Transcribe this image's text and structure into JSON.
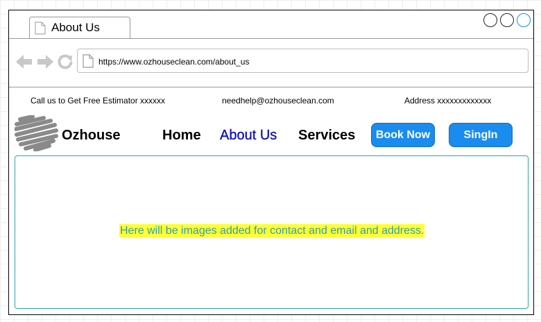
{
  "browser": {
    "tab_title": "About Us",
    "url": "https://www.ozhouseclean.com/about_us"
  },
  "topbar": {
    "call": "Call us to Get Free Estimator xxxxxx",
    "email": "needhelp@ozhouseclean.com",
    "address": "Address xxxxxxxxxxxxx"
  },
  "header": {
    "brand": "Ozhouse",
    "nav": [
      "Home",
      "About Us",
      "Services"
    ],
    "book_button": "Book Now",
    "signin_button": "SingIn"
  },
  "main": {
    "placeholder_text": "Here will be images added for contact and email and address."
  },
  "colors": {
    "accent": "#1a8cf0",
    "active_nav": "#1414c8",
    "highlight": "#ffff33",
    "content_border": "#2aa3b5"
  }
}
